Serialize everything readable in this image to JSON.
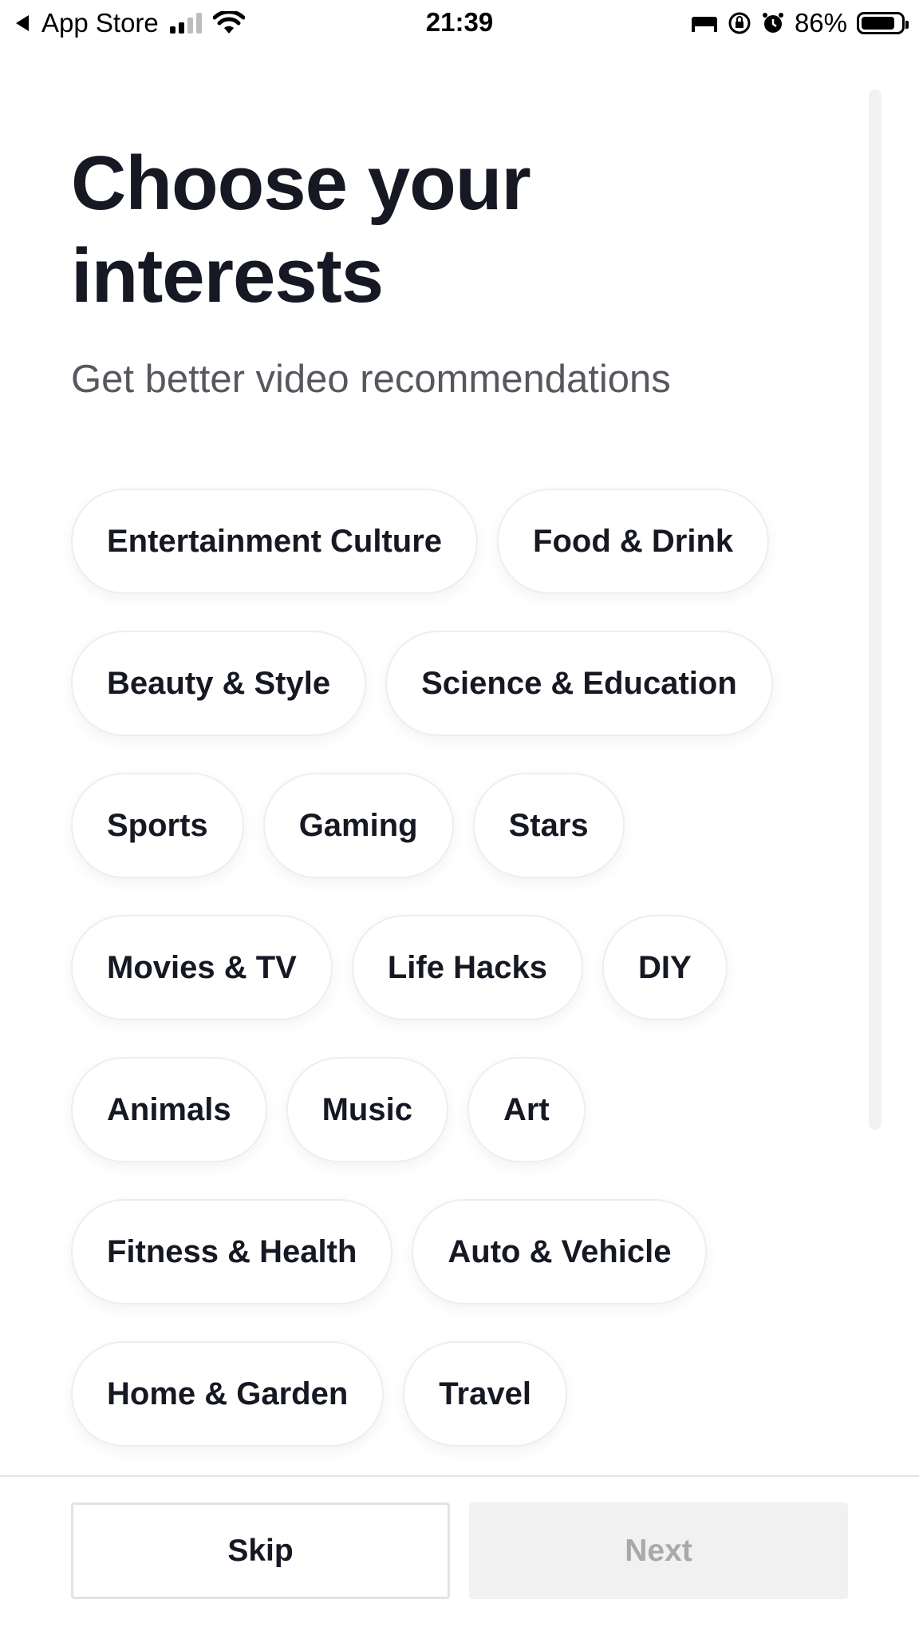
{
  "status_bar": {
    "back_app": "App Store",
    "time": "21:39",
    "battery": "86%",
    "battery_level": 0.86
  },
  "header": {
    "title": "Choose your interests",
    "subtitle": "Get better video recommendations"
  },
  "interests": [
    [
      "Entertainment Culture",
      "Food & Drink"
    ],
    [
      "Beauty & Style",
      "Science & Education"
    ],
    [
      "Sports",
      "Gaming",
      "Stars"
    ],
    [
      "Movies & TV",
      "Life Hacks",
      "DIY"
    ],
    [
      "Animals",
      "Music",
      "Art"
    ],
    [
      "Fitness & Health",
      "Auto & Vehicle"
    ],
    [
      "Home & Garden",
      "Travel"
    ]
  ],
  "footer": {
    "skip_label": "Skip",
    "next_label": "Next"
  },
  "colors": {
    "text": "#161823",
    "subtitle": "#57575f",
    "disabled_button": "#f1f1f2",
    "disabled_text": "#a8a8ad"
  }
}
